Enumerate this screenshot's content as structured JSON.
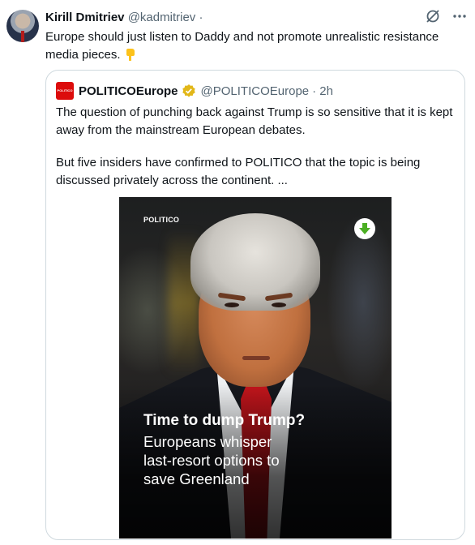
{
  "tweet": {
    "author_name": "Kirill Dmitriev",
    "author_handle": "@kadmitriev",
    "separator": "·",
    "text": "Europe should just listen to Daddy and not promote unrealistic resistance media pieces.",
    "emoji": "backhand-index-pointing-down"
  },
  "quote": {
    "logo_text": "POLITICO",
    "author_name": "POLITICOEurope",
    "author_handle": "@POLITICOEurope",
    "time": "· 2h",
    "paragraphs": [
      "The question of punching back against Trump is so sensitive that it is kept away from the mainstream European debates.",
      "But five insiders have confirmed to POLITICO that the topic is being discussed privately across the continent. ..."
    ]
  },
  "media": {
    "brand": "POLITICO",
    "headline": "Time to dump Trump?",
    "subtitle_lines": [
      "Europeans whisper",
      "last-resort options to",
      "save Greenland"
    ]
  },
  "colors": {
    "text": "#0f1419",
    "muted": "#536471",
    "border": "#cfd9de",
    "politico_red": "#dc0c0c",
    "verified_gold": "#e2b719",
    "download_green": "#4caf24"
  }
}
